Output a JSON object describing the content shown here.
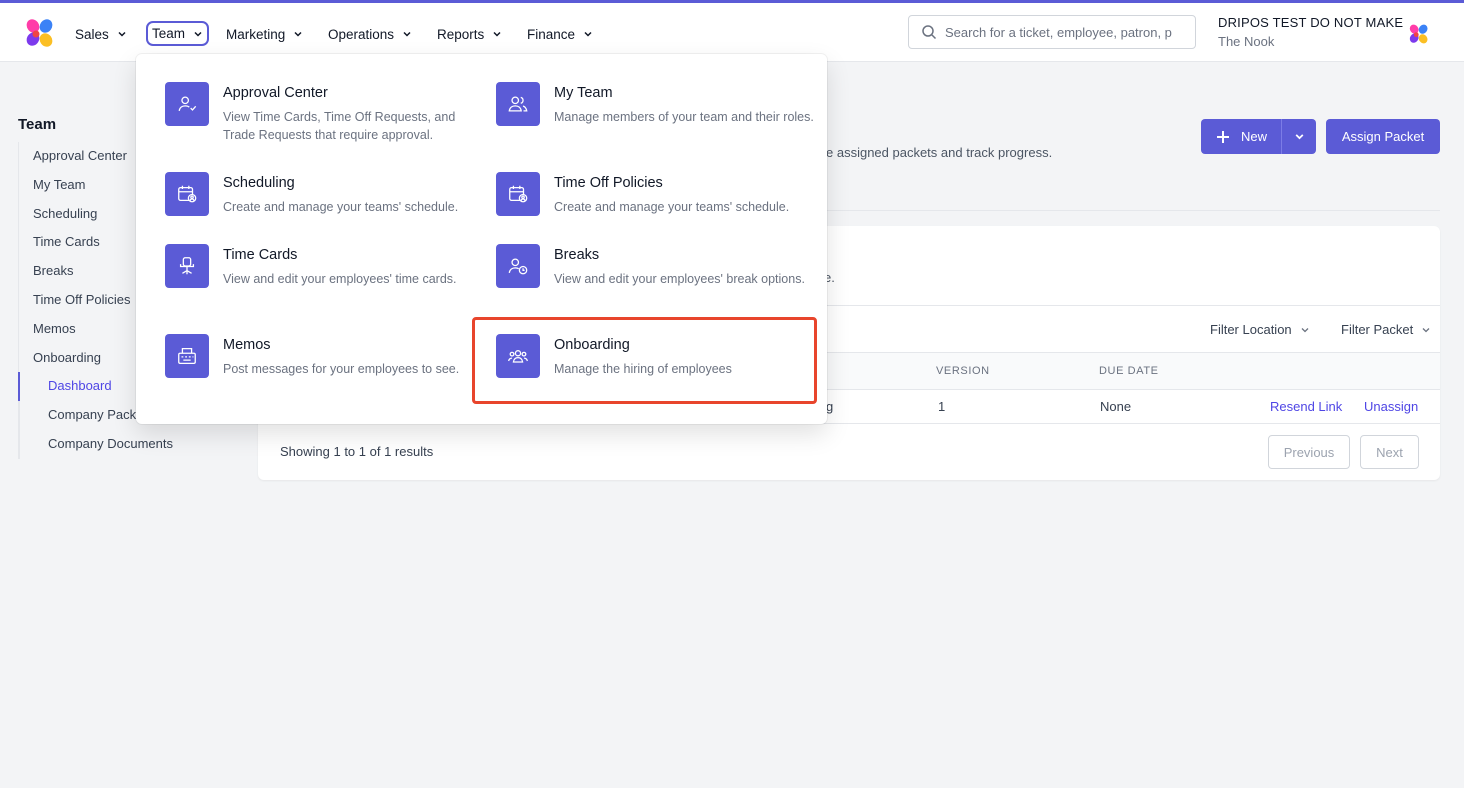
{
  "brand": {
    "colors": {
      "accent": "#5b5bd6",
      "highlight": "#e8452c"
    }
  },
  "nav": {
    "items": [
      {
        "label": "Sales",
        "active": false
      },
      {
        "label": "Team",
        "active": true
      },
      {
        "label": "Marketing",
        "active": false
      },
      {
        "label": "Operations",
        "active": false
      },
      {
        "label": "Reports",
        "active": false
      },
      {
        "label": "Finance",
        "active": false
      }
    ]
  },
  "search": {
    "placeholder": "Search for a ticket, employee, patron, p"
  },
  "account": {
    "name": "DRIPOS TEST DO NOT MAKE",
    "location": "The Nook"
  },
  "sidebar": {
    "title": "Team",
    "items": [
      {
        "label": "Approval Center"
      },
      {
        "label": "My Team"
      },
      {
        "label": "Scheduling"
      },
      {
        "label": "Time Cards"
      },
      {
        "label": "Breaks"
      },
      {
        "label": "Time Off Policies"
      },
      {
        "label": "Memos"
      },
      {
        "label": "Onboarding"
      }
    ],
    "subitems": [
      {
        "label": "Dashboard",
        "current": true
      },
      {
        "label": "Company Pack"
      },
      {
        "label": "Company Documents"
      }
    ]
  },
  "main": {
    "new_label": "New",
    "assign_label": "Assign Packet",
    "subtitle_tail": "e assigned packets and track progress.",
    "card_desc_tail": "e.",
    "filters": {
      "location": "Filter Location",
      "packet": "Filter Packet"
    },
    "table": {
      "headers": {
        "version": "VERSION",
        "due_date": "DUE DATE"
      },
      "row": {
        "name_tail": "g",
        "version": "1",
        "due_date": "None",
        "resend": "Resend Link",
        "unassign": "Unassign"
      }
    },
    "pagination": {
      "showing": "Showing 1 to 1 of 1 results",
      "previous": "Previous",
      "next": "Next"
    }
  },
  "mega_menu": {
    "items": [
      {
        "title": "Approval Center",
        "desc": "View Time Cards, Time Off Requests, and Trade Requests that require approval.",
        "icon": "user-check-icon"
      },
      {
        "title": "My Team",
        "desc": "Manage members of your team and their roles.",
        "icon": "users-icon"
      },
      {
        "title": "Scheduling",
        "desc": "Create and manage your teams' schedule.",
        "icon": "calendar-user-icon"
      },
      {
        "title": "Time Off Policies",
        "desc": "Create and manage your teams' schedule.",
        "icon": "calendar-user-icon"
      },
      {
        "title": "Time Cards",
        "desc": "View and edit your employees' time cards.",
        "icon": "office-chair-icon"
      },
      {
        "title": "Breaks",
        "desc": "View and edit your employees' break options.",
        "icon": "user-clock-icon"
      },
      {
        "title": "Memos",
        "desc": "Post messages for your employees to see.",
        "icon": "typewriter-icon"
      },
      {
        "title": "Onboarding",
        "desc": "Manage the hiring of employees",
        "icon": "user-group-icon"
      }
    ]
  }
}
